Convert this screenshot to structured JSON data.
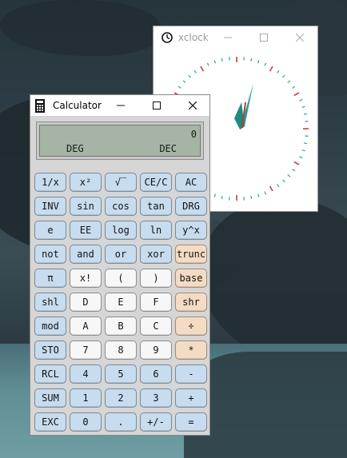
{
  "desktop": {
    "wallpaper": "rocky-coastline"
  },
  "xclock": {
    "title": "xclock",
    "icon": "clock-icon",
    "controls": [
      "minimize-icon",
      "maximize-icon",
      "close-icon"
    ],
    "colors": {
      "tick": "#2aa198",
      "hour_mark": "#d23c3c",
      "hand": "#2aa198",
      "hand_accent": "#c0392b"
    }
  },
  "calculator": {
    "title": "Calculator",
    "icon": "calculator-icon",
    "controls": [
      "minimize-icon",
      "maximize-icon",
      "close-icon"
    ],
    "display": {
      "value": "0",
      "angle_mode": "DEG",
      "base_mode": "DEC"
    },
    "keys": [
      [
        {
          "label": "1/x",
          "style": "blue"
        },
        {
          "label": "x²",
          "style": "blue"
        },
        {
          "label": "√‾",
          "style": "blue"
        },
        {
          "label": "CE/C",
          "style": "blue"
        },
        {
          "label": "AC",
          "style": "blue"
        }
      ],
      [
        {
          "label": "INV",
          "style": "blue"
        },
        {
          "label": "sin",
          "style": "blue"
        },
        {
          "label": "cos",
          "style": "blue"
        },
        {
          "label": "tan",
          "style": "blue"
        },
        {
          "label": "DRG",
          "style": "blue"
        }
      ],
      [
        {
          "label": "e",
          "style": "blue"
        },
        {
          "label": "EE",
          "style": "blue"
        },
        {
          "label": "log",
          "style": "blue"
        },
        {
          "label": "ln",
          "style": "blue"
        },
        {
          "label": "y^x",
          "style": "blue"
        }
      ],
      [
        {
          "label": "not",
          "style": "blue"
        },
        {
          "label": "and",
          "style": "blue"
        },
        {
          "label": "or",
          "style": "blue"
        },
        {
          "label": "xor",
          "style": "blue"
        },
        {
          "label": "trunc",
          "style": "orange"
        }
      ],
      [
        {
          "label": "π",
          "style": "blue"
        },
        {
          "label": "x!",
          "style": "white"
        },
        {
          "label": "(",
          "style": "white"
        },
        {
          "label": ")",
          "style": "white"
        },
        {
          "label": "base",
          "style": "orange"
        }
      ],
      [
        {
          "label": "shl",
          "style": "blue"
        },
        {
          "label": "D",
          "style": "white"
        },
        {
          "label": "E",
          "style": "white"
        },
        {
          "label": "F",
          "style": "white"
        },
        {
          "label": "shr",
          "style": "orange"
        }
      ],
      [
        {
          "label": "mod",
          "style": "blue"
        },
        {
          "label": "A",
          "style": "white"
        },
        {
          "label": "B",
          "style": "white"
        },
        {
          "label": "C",
          "style": "white"
        },
        {
          "label": "÷",
          "style": "orange"
        }
      ],
      [
        {
          "label": "STO",
          "style": "blue"
        },
        {
          "label": "7",
          "style": "white"
        },
        {
          "label": "8",
          "style": "white"
        },
        {
          "label": "9",
          "style": "white"
        },
        {
          "label": "*",
          "style": "orange"
        }
      ],
      [
        {
          "label": "RCL",
          "style": "blue"
        },
        {
          "label": "4",
          "style": "blue"
        },
        {
          "label": "5",
          "style": "blue"
        },
        {
          "label": "6",
          "style": "blue"
        },
        {
          "label": "-",
          "style": "blue"
        }
      ],
      [
        {
          "label": "SUM",
          "style": "blue"
        },
        {
          "label": "1",
          "style": "blue"
        },
        {
          "label": "2",
          "style": "blue"
        },
        {
          "label": "3",
          "style": "blue"
        },
        {
          "label": "+",
          "style": "blue"
        }
      ],
      [
        {
          "label": "EXC",
          "style": "blue"
        },
        {
          "label": "0",
          "style": "blue"
        },
        {
          "label": ".",
          "style": "blue"
        },
        {
          "label": "+/-",
          "style": "blue"
        },
        {
          "label": "=",
          "style": "blue"
        }
      ]
    ]
  }
}
